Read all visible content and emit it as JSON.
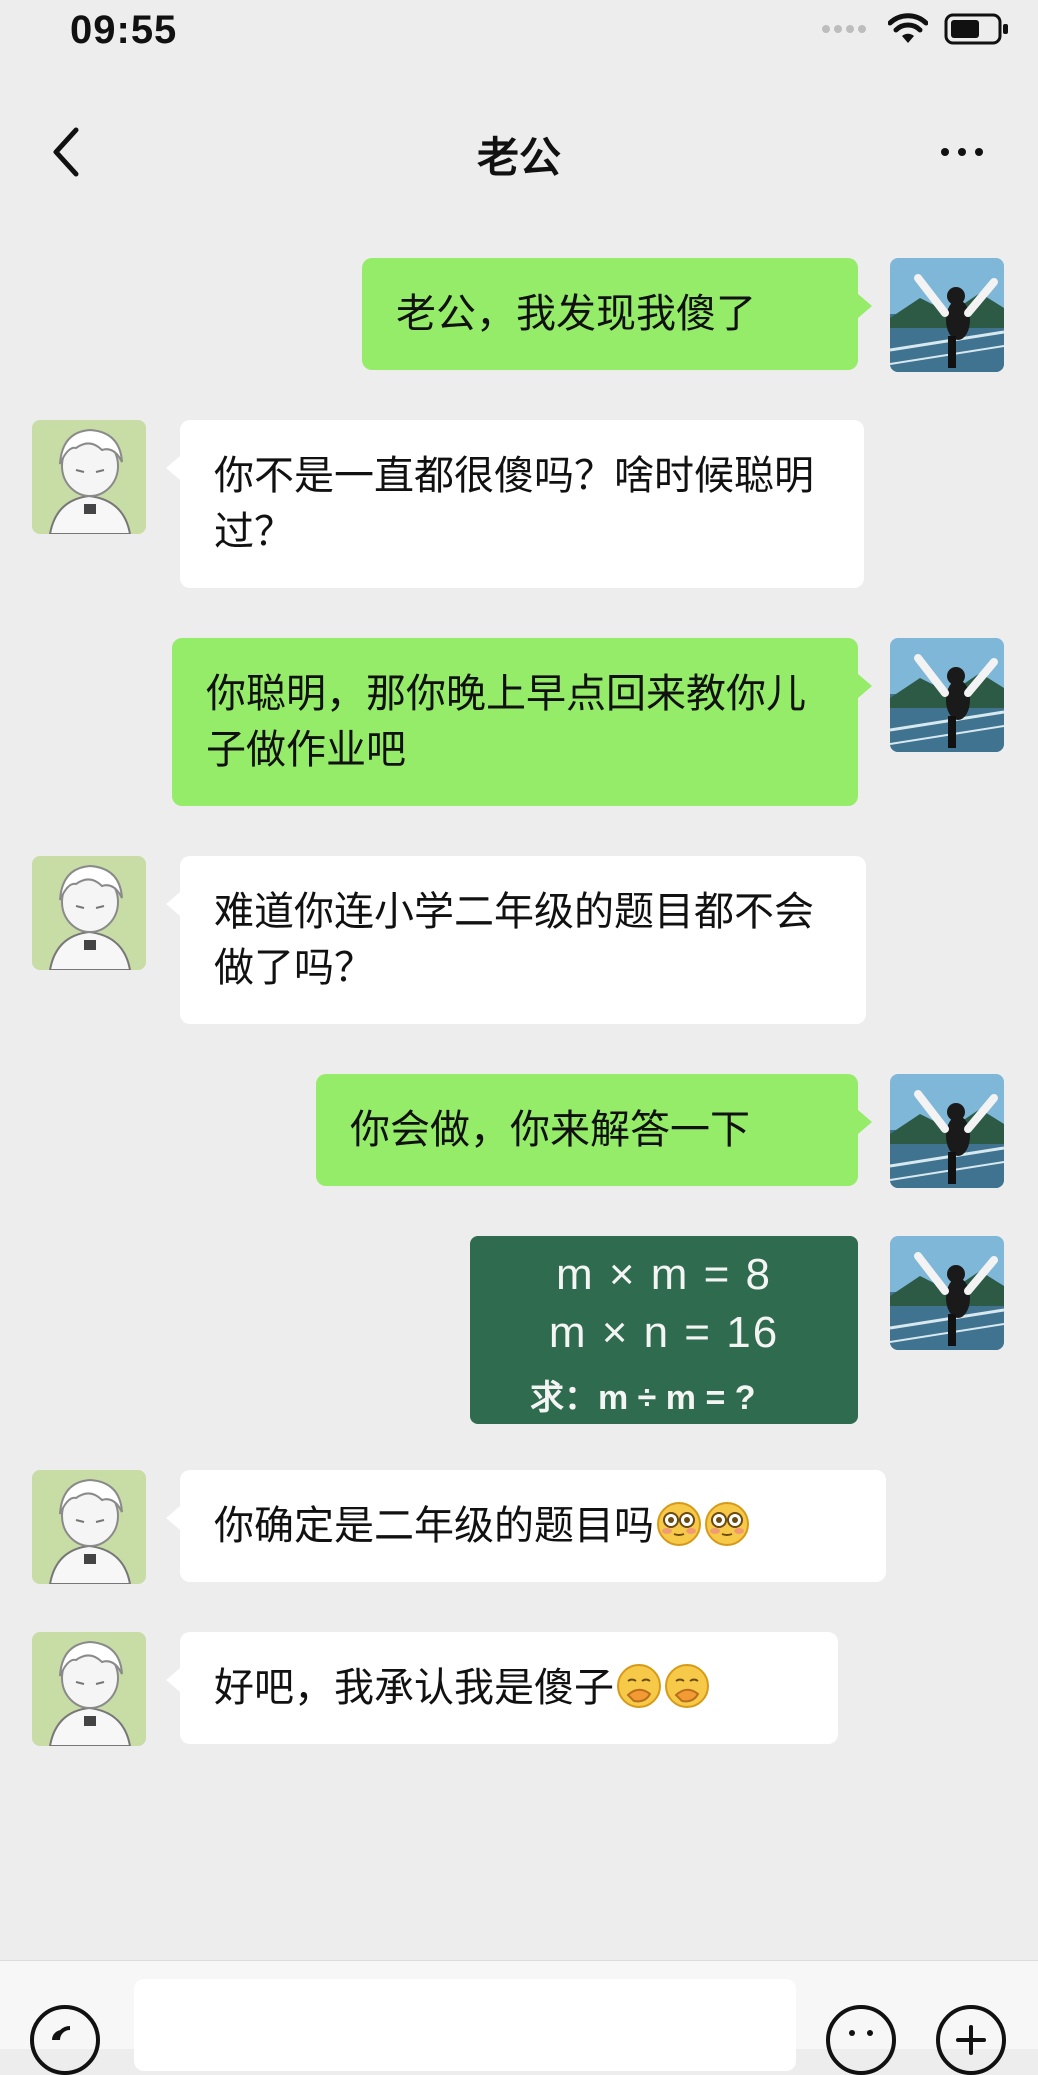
{
  "status_bar": {
    "time": "09:55",
    "wifi_icon": "wifi-icon",
    "battery_icon": "battery-icon"
  },
  "nav": {
    "title": "老公",
    "back_icon": "chevron-left-icon",
    "more_icon": "more-horizontal-icon"
  },
  "messages": [
    {
      "from": "me",
      "text": "老公，我发现我傻了"
    },
    {
      "from": "other",
      "text": "你不是一直都很傻吗？啥时候聪明过？"
    },
    {
      "from": "me",
      "text": "你聪明，那你晚上早点回来教你儿子做作业吧"
    },
    {
      "from": "other",
      "text": "难道你连小学二年级的题目都不会做了吗？"
    },
    {
      "from": "me",
      "text": "你会做，你来解答一下"
    },
    {
      "from": "me",
      "type": "image",
      "image": {
        "line1": "m × m = 8",
        "line2": "m × n = 16",
        "line3": "求：m ÷ m = ?"
      }
    },
    {
      "from": "other",
      "text": "你确定是二年级的题目吗",
      "emoji": [
        "flushed-face-icon",
        "flushed-face-icon"
      ]
    },
    {
      "from": "other",
      "text": "好吧，我承认我是傻子",
      "emoji": [
        "hand-over-mouth-face-icon",
        "hand-over-mouth-face-icon"
      ]
    }
  ],
  "input_bar": {
    "voice_icon": "voice-icon",
    "emoji_icon": "emoji-icon",
    "plus_icon": "plus-icon"
  },
  "colors": {
    "background": "#ededed",
    "sent_bubble": "#95ec69",
    "received_bubble": "#ffffff",
    "math_card": "#2f6b4e"
  }
}
